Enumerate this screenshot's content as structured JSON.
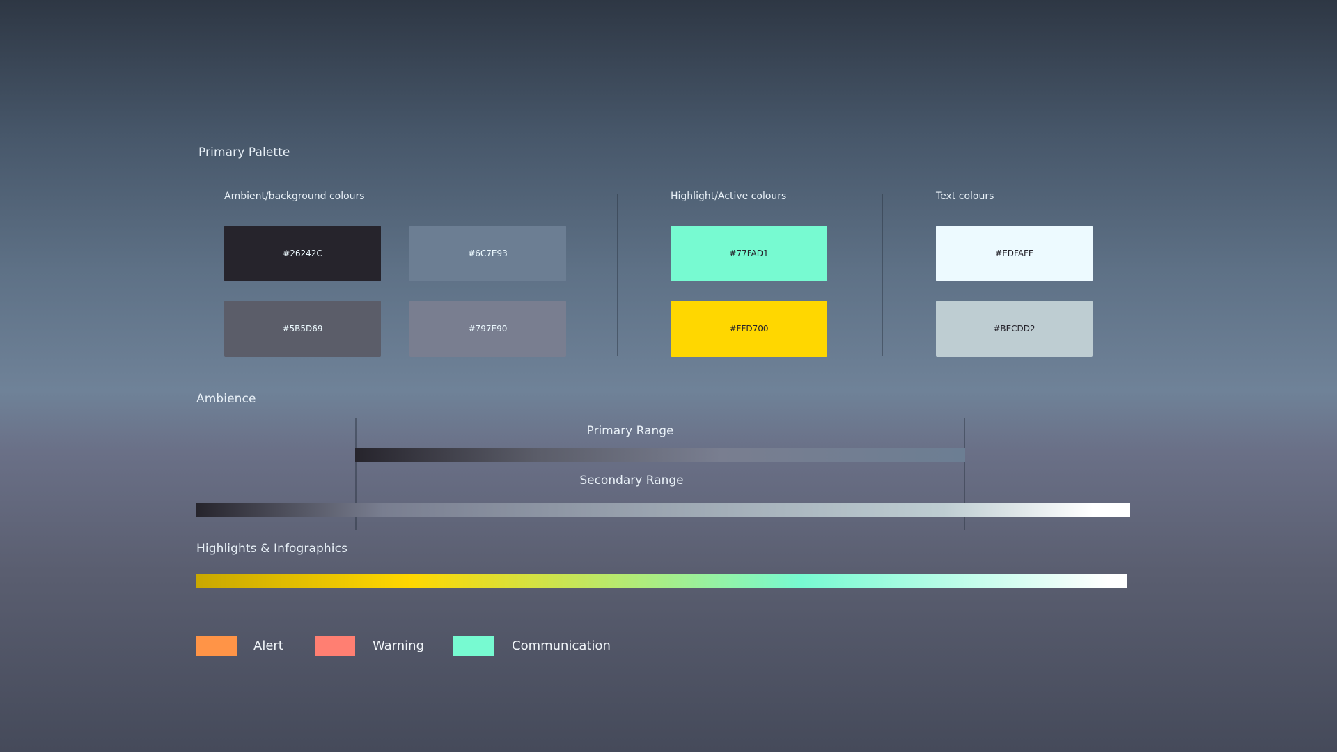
{
  "primary_palette": {
    "title": "Primary Palette",
    "groups": [
      {
        "title": "Ambient/background colours",
        "swatches": [
          {
            "label": "#26242C",
            "color": "#26242C",
            "text_color": "#EDFAFF"
          },
          {
            "label": "#6C7E93",
            "color": "#6C7E93",
            "text_color": "#EDFAFF"
          },
          {
            "label": "#5B5D69",
            "color": "#5B5D69",
            "text_color": "#EDFAFF"
          },
          {
            "label": "#797E90",
            "color": "#797E90",
            "text_color": "#EDFAFF"
          }
        ]
      },
      {
        "title": "Highlight/Active colours",
        "swatches": [
          {
            "label": "#77FAD1",
            "color": "#77FAD1",
            "text_color": "#26242C"
          },
          {
            "label": "#FFD700",
            "color": "#FFD700",
            "text_color": "#26242C"
          }
        ]
      },
      {
        "title": "Text colours",
        "swatches": [
          {
            "label": "#EDFAFF",
            "color": "#EDFAFF",
            "text_color": "#26242C"
          },
          {
            "label": "#BECDD2",
            "color": "#BECDD2",
            "text_color": "#26242C"
          }
        ]
      }
    ]
  },
  "ambience": {
    "title": "Ambience",
    "primary_range_label": "Primary Range",
    "secondary_range_label": "Secondary Range",
    "primary_gradient": [
      "#26242C",
      "#5B5D69",
      "#797E90",
      "#6C7E93"
    ],
    "secondary_gradient": [
      "#26242C",
      "#797E90",
      "#BECDD2",
      "#FFFFFF"
    ]
  },
  "highlights": {
    "title": "Highlights & Infographics",
    "gradient": [
      "#C9A800",
      "#FFD700",
      "#77FAD1",
      "#FFFFFF"
    ]
  },
  "legend": [
    {
      "label": "Alert",
      "color": "#FF9447"
    },
    {
      "label": "Warning",
      "color": "#FF7F72"
    },
    {
      "label": "Communication",
      "color": "#77FAD1"
    }
  ]
}
